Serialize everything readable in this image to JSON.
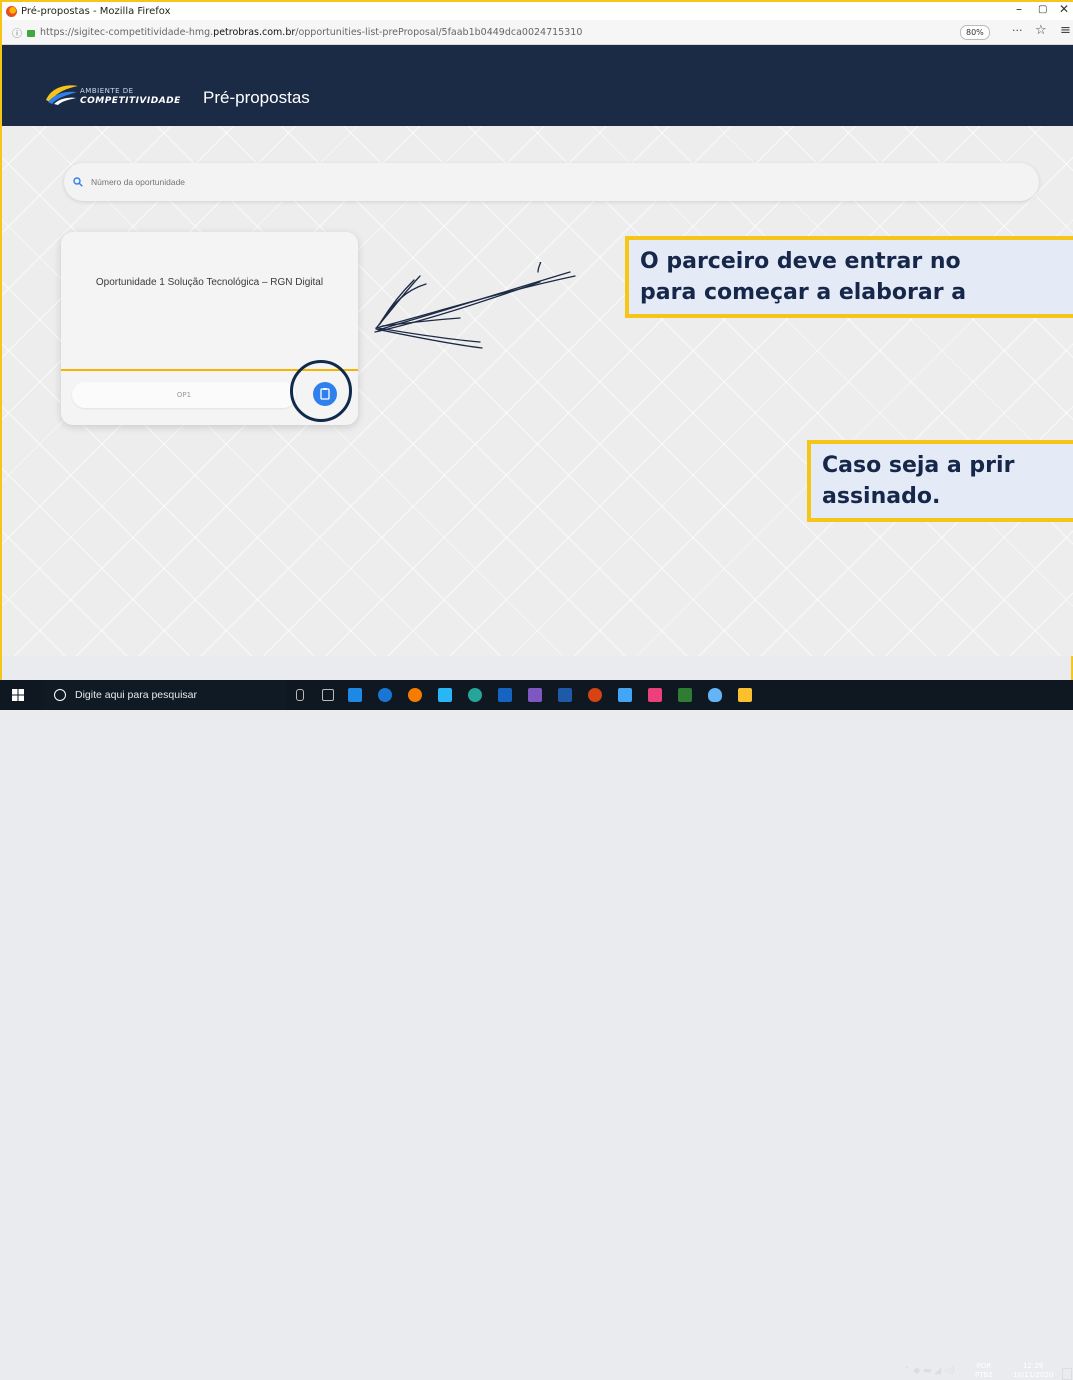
{
  "browser": {
    "window_title": "Pré-propostas - Mozilla Firefox",
    "url_prefix": "https://sigitec-competitividade-hmg.",
    "url_host": "petrobras.com.br",
    "url_path": "/opportunities-list-preProposal/5faab1b0449dca0024715310",
    "zoom": "80%",
    "minimize": "–",
    "maximize": "▢",
    "close": "✕",
    "more": "···",
    "bookmark": "☆",
    "menu": "≡"
  },
  "app": {
    "logo_line1": "AMBIENTE DE",
    "logo_line2": "COMPETITIVIDADE",
    "page_title": "Pré-propostas"
  },
  "search": {
    "placeholder": "Número da oportunidade"
  },
  "card": {
    "title": "Oportunidade 1 Solução Tecnológica – RGN Digital",
    "code": "OP1"
  },
  "callouts": {
    "first_line1": "O parceiro deve entrar no",
    "first_line2": "para começar a elaborar a",
    "second_line1": "Caso seja a prir",
    "second_line2": "assinado."
  },
  "taskbar": {
    "search_placeholder": "Digite aqui para pesquisar",
    "lang_line1": "POR",
    "lang_line2": "PTB2",
    "time": "12:29",
    "date": "10/11/2020"
  },
  "colors": {
    "header_bg": "#1b2b46",
    "accent_yellow": "#f5c518",
    "button_blue": "#2f80ed",
    "callout_bg": "#e4ebf7"
  }
}
